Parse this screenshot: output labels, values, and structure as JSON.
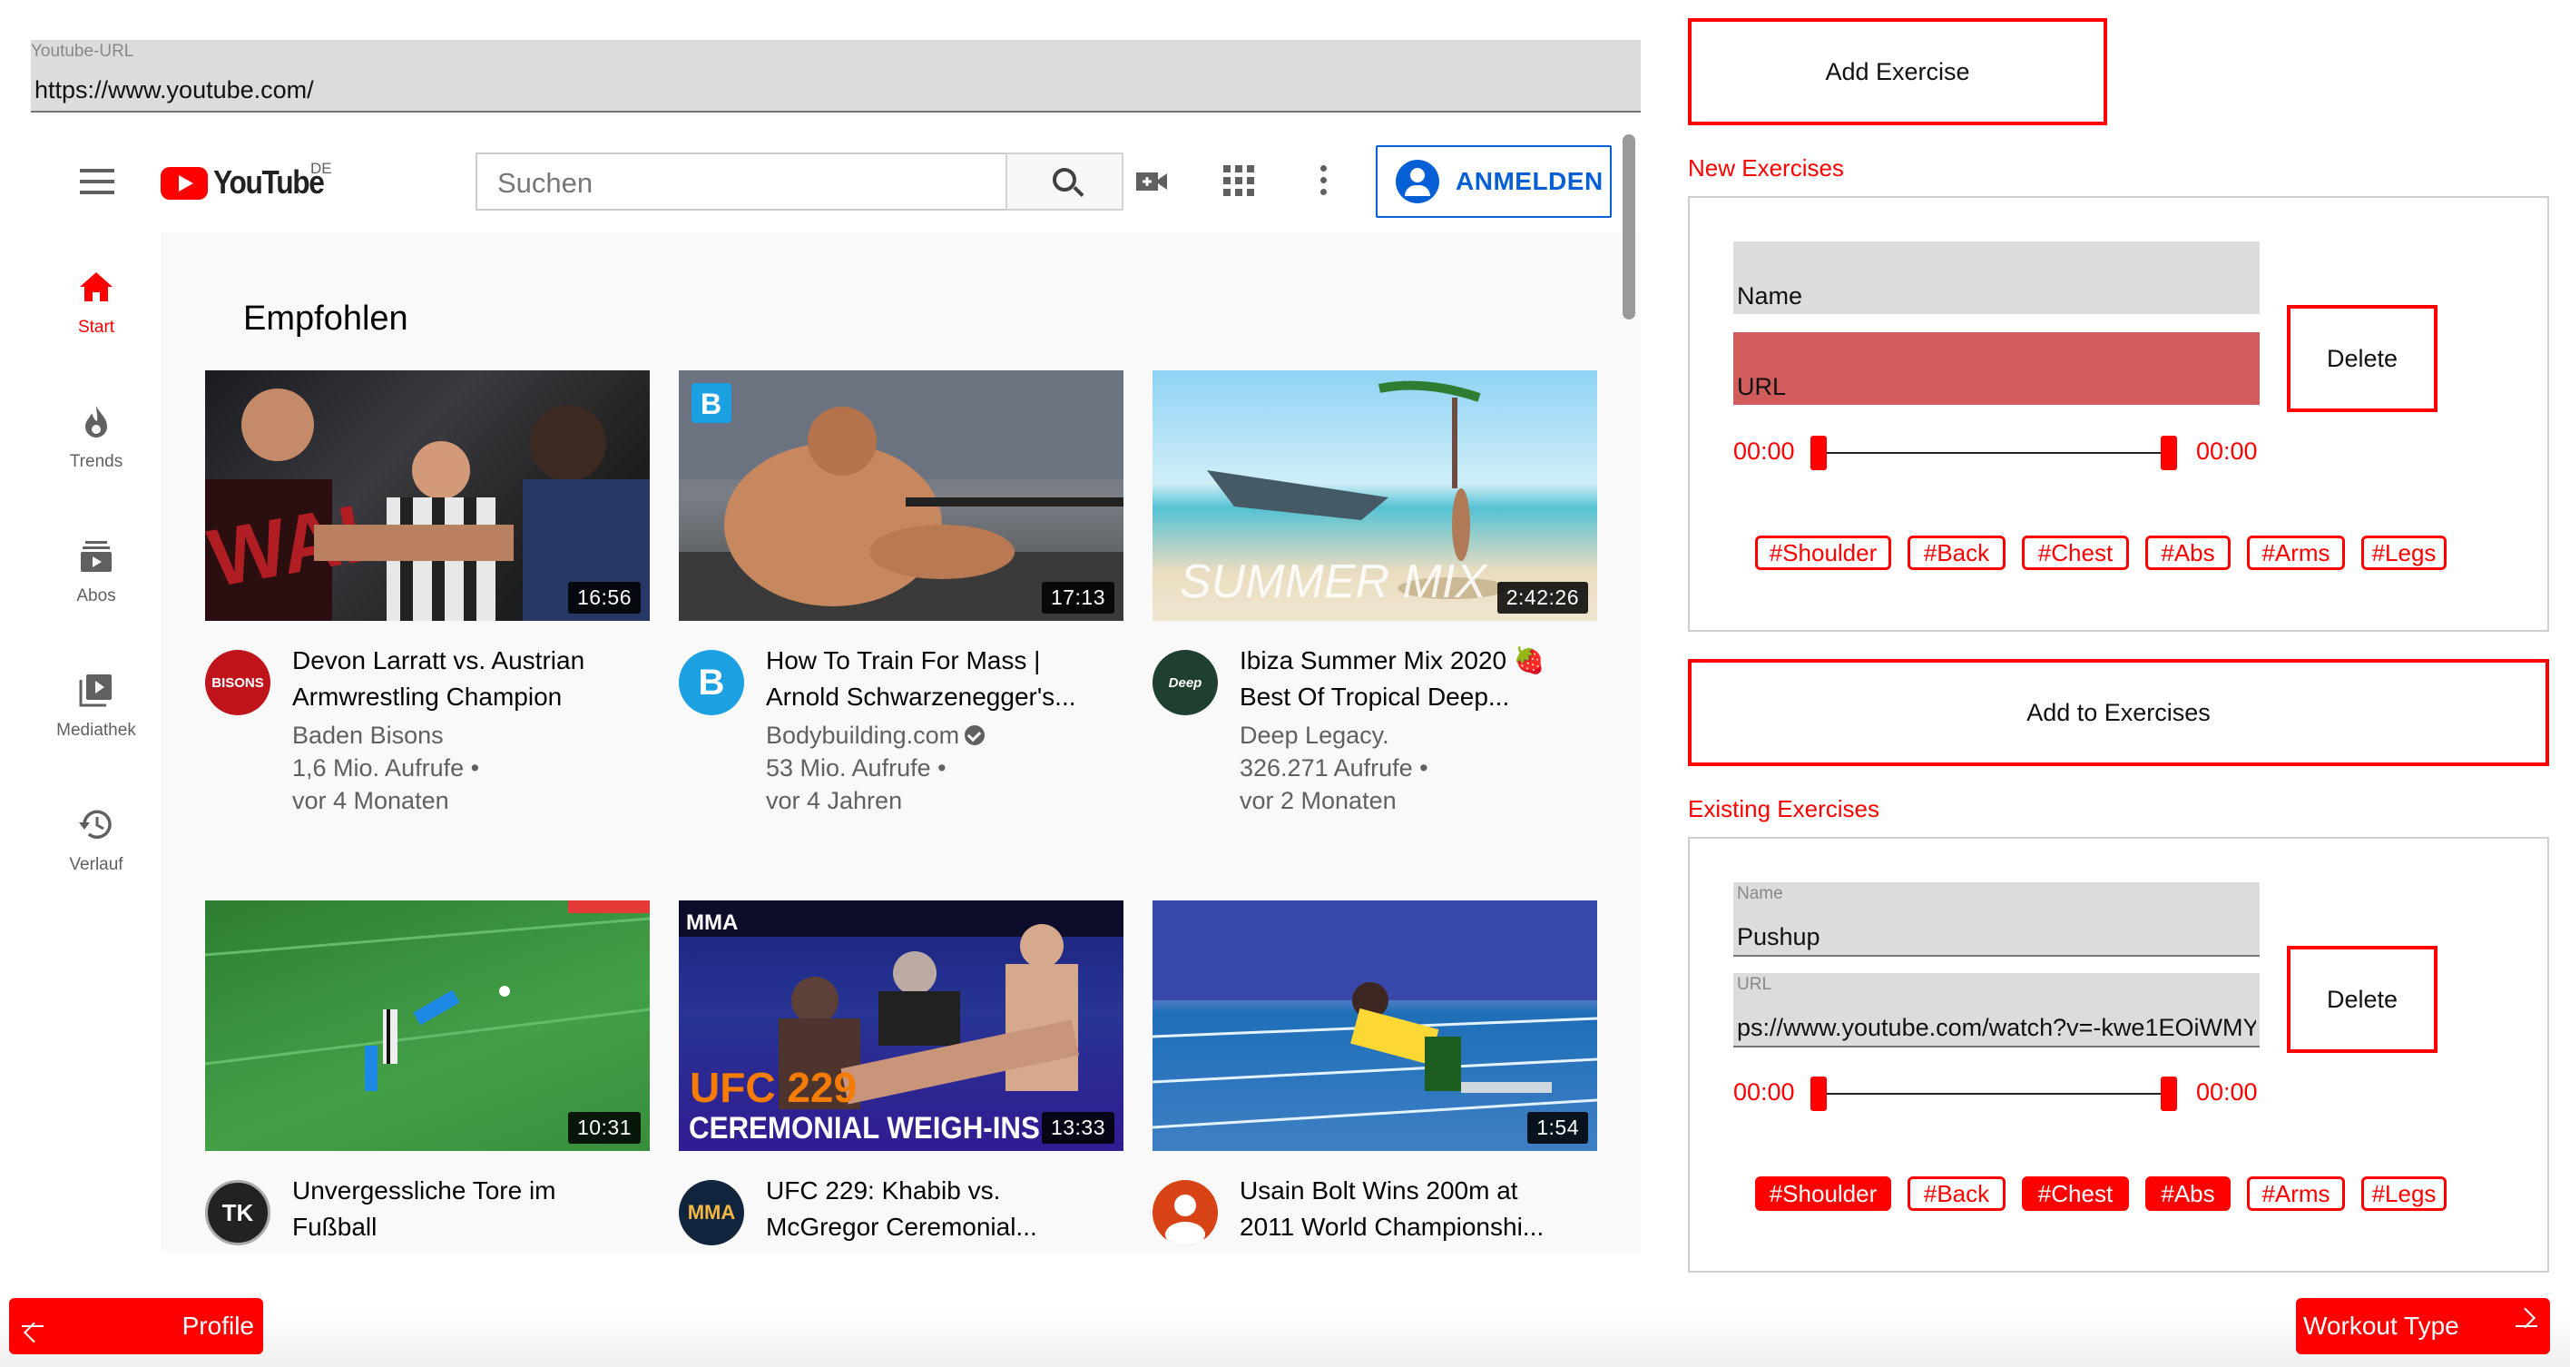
{
  "url_field": {
    "label": "Youtube-URL",
    "value": "https://www.youtube.com/"
  },
  "youtube": {
    "logo_text": "YouTube",
    "region": "DE",
    "search_placeholder": "Suchen",
    "signin_label": "ANMELDEN",
    "nav": [
      {
        "label": "Start",
        "icon": "home-icon"
      },
      {
        "label": "Trends",
        "icon": "flame-icon"
      },
      {
        "label": "Abos",
        "icon": "subscriptions-icon"
      },
      {
        "label": "Mediathek",
        "icon": "library-icon"
      },
      {
        "label": "Verlauf",
        "icon": "history-icon"
      }
    ],
    "section_title": "Empfohlen",
    "videos": [
      {
        "title1": "Devon Larratt vs. Austrian",
        "title2": "Armwrestling Champion",
        "channel": "Baden Bisons",
        "views": "1,6 Mio. Aufrufe •",
        "age": "vor 4 Monaten",
        "duration": "16:56",
        "verified": false
      },
      {
        "title1": "How To Train For Mass |",
        "title2": "Arnold Schwarzenegger's...",
        "channel": "Bodybuilding.com",
        "views": "53 Mio. Aufrufe •",
        "age": "vor 4 Jahren",
        "duration": "17:13",
        "verified": true
      },
      {
        "title1": "Ibiza Summer Mix 2020 🍓",
        "title2": "Best Of Tropical Deep...",
        "channel": "Deep Legacy.",
        "views": "326.271 Aufrufe •",
        "age": "vor 2 Monaten",
        "duration": "2:42:26",
        "verified": false
      },
      {
        "title1": "Unvergessliche Tore im",
        "title2": "Fußball",
        "duration": "10:31"
      },
      {
        "title1": "UFC 229: Khabib vs.",
        "title2": "McGregor Ceremonial...",
        "duration": "13:33"
      },
      {
        "title1": "Usain Bolt Wins 200m at",
        "title2": "2011 World Championshi...",
        "duration": "1:54"
      }
    ],
    "thumb_texts": {
      "summer": "SUMMER MIX",
      "ufc1": "UFC 229",
      "ufc2": "CEREMONIAL WEIGH-INS",
      "mma": "MMA",
      "avatar_tk": "TK",
      "avatar_bisons": "BISONS",
      "avatar_deep": "Deep"
    }
  },
  "panel": {
    "add_exercise": "Add Exercise",
    "new_title": "New Exercises",
    "new_card": {
      "name_value": "Name",
      "url_value": "URL",
      "start": "00:00",
      "end": "00:00",
      "delete": "Delete",
      "start_pos": 0.0,
      "end_pos": 1.0
    },
    "tags": [
      "#Shoulder",
      "#Back",
      "#Chest",
      "#Abs",
      "#Arms",
      "#Legs"
    ],
    "add_to": "Add to Exercises",
    "existing_title": "Existing Exercises",
    "existing_card": {
      "name_label": "Name",
      "name_value": "Pushup",
      "url_label": "URL",
      "url_value": "ps://www.youtube.com/watch?v=-kwe1EOiWMY",
      "start": "00:00",
      "end": "00:00",
      "delete": "Delete",
      "selected_tags": [
        "#Shoulder",
        "#Chest",
        "#Abs"
      ],
      "start_pos": 0.0,
      "end_pos": 1.0
    }
  },
  "footer": {
    "profile": "Profile",
    "workout_type": "Workout Type"
  },
  "colors": {
    "accent": "#ff0000",
    "yt_blue": "#065fd4",
    "field_bg": "#dcdcdc",
    "error_field": "#d05c5c"
  }
}
